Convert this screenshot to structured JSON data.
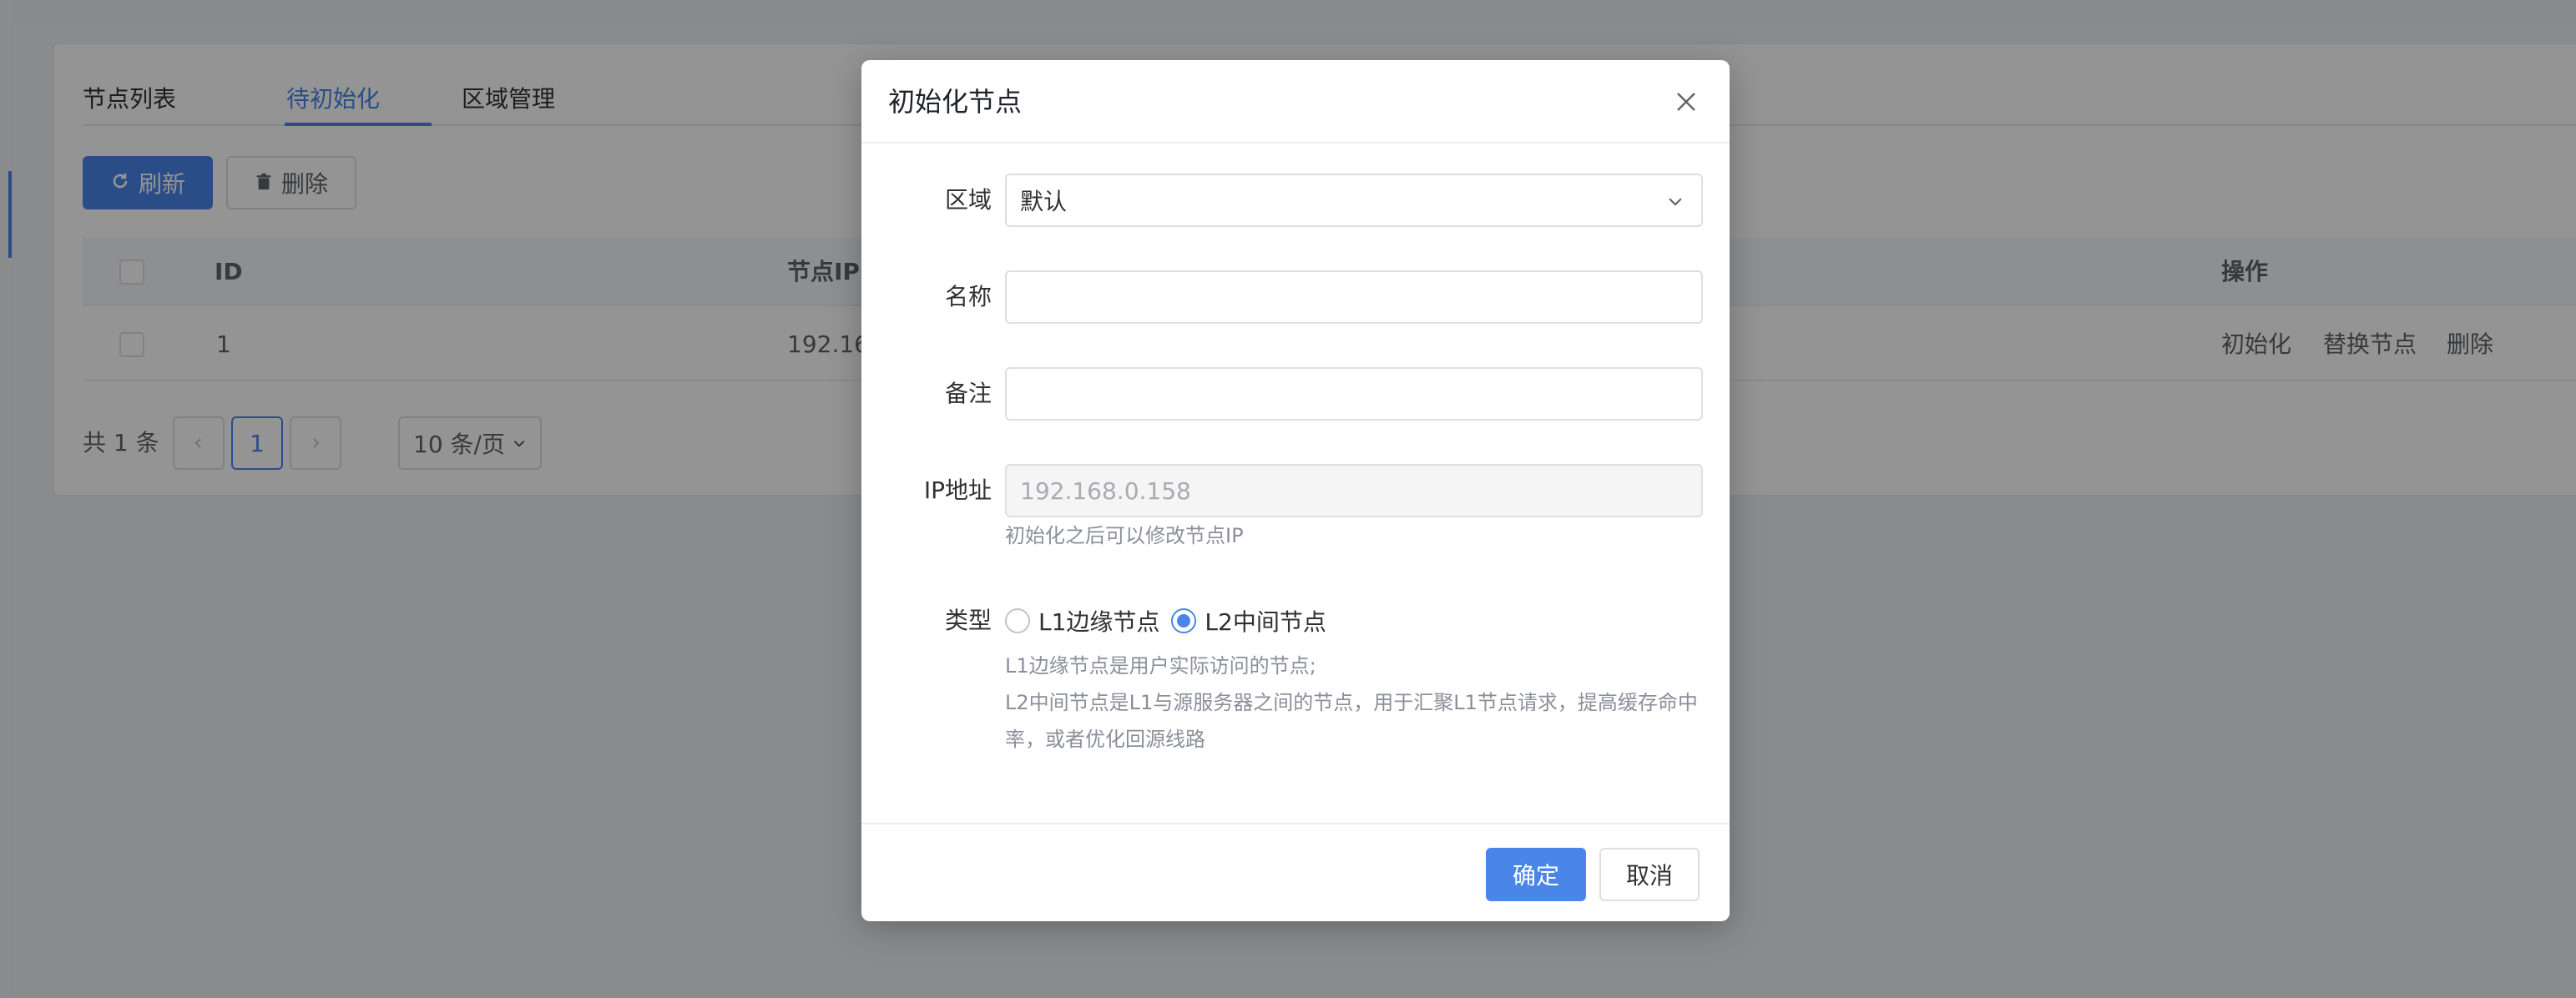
{
  "tabs": [
    {
      "label": "节点列表"
    },
    {
      "label": "待初始化"
    },
    {
      "label": "区域管理"
    }
  ],
  "toolbar": {
    "refresh_label": "刷新",
    "delete_label": "删除"
  },
  "table": {
    "headers": {
      "id": "ID",
      "ip": "节点IP",
      "ops": "操作"
    },
    "rows": [
      {
        "id": "1",
        "ip": "192.168",
        "op_init": "初始化",
        "op_replace": "替换节点",
        "op_delete": "删除"
      }
    ]
  },
  "pagination": {
    "total_text": "共 1 条",
    "current_page": "1",
    "page_size": "10 条/页"
  },
  "modal": {
    "title": "初始化节点",
    "region": {
      "label": "区域",
      "value": "默认"
    },
    "name": {
      "label": "名称",
      "value": ""
    },
    "remark": {
      "label": "备注",
      "value": ""
    },
    "ip": {
      "label": "IP地址",
      "value": "192.168.0.158",
      "help": "初始化之后可以修改节点IP"
    },
    "type": {
      "label": "类型",
      "options": [
        {
          "label": "L1边缘节点",
          "checked": false
        },
        {
          "label": "L2中间节点",
          "checked": true
        }
      ],
      "help_line1": "L1边缘节点是用户实际访问的节点;",
      "help_line2": "L2中间节点是L1与源服务器之间的节点，用于汇聚L1节点请求，提高缓存命中",
      "help_line3": "率，或者优化回源线路"
    },
    "ok_label": "确定",
    "cancel_label": "取消"
  },
  "colors": {
    "accent": "#4a86e8",
    "mask": "rgba(0,0,0,0.42)"
  }
}
